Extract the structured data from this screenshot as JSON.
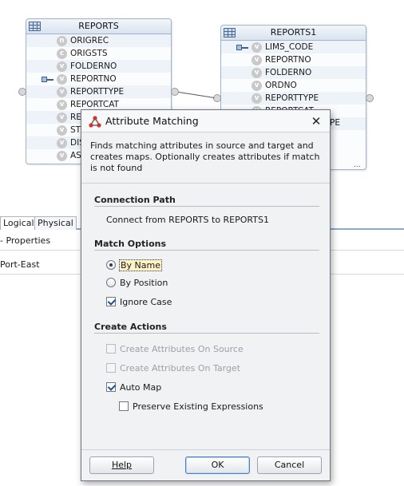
{
  "diagram": {
    "reports": {
      "title": "REPORTS",
      "attributes": [
        {
          "name": "ORIGREC",
          "badge": "n",
          "key": false
        },
        {
          "name": "ORIGSTS",
          "badge": "c",
          "key": false
        },
        {
          "name": "FOLDERNO",
          "badge": "v",
          "key": false
        },
        {
          "name": "REPORTNO",
          "badge": "v",
          "key": true
        },
        {
          "name": "REPORTTYPE",
          "badge": "v",
          "key": false
        },
        {
          "name": "REPORTCAT",
          "badge": "v",
          "key": false
        },
        {
          "name": "RE",
          "badge": "v",
          "key": false
        },
        {
          "name": "ST",
          "badge": "v",
          "key": false
        },
        {
          "name": "DIS",
          "badge": "v",
          "key": false
        },
        {
          "name": "AS",
          "badge": "v",
          "key": false
        }
      ]
    },
    "reports1": {
      "title": "REPORTS1",
      "attributes": [
        {
          "name": "LIMS_CODE",
          "badge": "v",
          "key": true
        },
        {
          "name": "REPORTNO",
          "badge": "v",
          "key": false
        },
        {
          "name": "FOLDERNO",
          "badge": "v",
          "key": false
        },
        {
          "name": "ORDNO",
          "badge": "v",
          "key": false
        },
        {
          "name": "REPORTTYPE",
          "badge": "v",
          "key": false
        },
        {
          "name": "REPORTCAT",
          "badge": "v",
          "key": false
        },
        {
          "name": "",
          "badge": "v",
          "key": false
        }
      ],
      "partial_label": "PE",
      "ellipsis": "..."
    }
  },
  "tabs": [
    "Logical",
    "Physical"
  ],
  "properties": {
    "title": "- Properties",
    "value": "Port-East"
  },
  "dialog": {
    "title": "Attribute Matching",
    "description": "Finds matching attributes in source and target and creates maps.  Optionally creates attributes if match is not found",
    "connection_path": {
      "heading": "Connection Path",
      "text": "Connect from REPORTS to REPORTS1"
    },
    "match_options": {
      "heading": "Match Options",
      "by_name": "By Name",
      "by_position": "By Position",
      "selected": "By Name",
      "ignore_case": {
        "label": "Ignore Case",
        "checked": true
      }
    },
    "create_actions": {
      "heading": "Create Actions",
      "create_on_source": {
        "label": "Create Attributes On Source",
        "checked": false,
        "enabled": false
      },
      "create_on_target": {
        "label": "Create Attributes On Target",
        "checked": false,
        "enabled": false
      },
      "auto_map": {
        "label": "Auto Map",
        "checked": true,
        "enabled": true
      },
      "preserve_existing": {
        "label": "Preserve Existing Expressions",
        "checked": false,
        "enabled": true
      }
    },
    "buttons": {
      "help": "Help",
      "ok": "OK",
      "cancel": "Cancel"
    },
    "close_glyph": "✕"
  }
}
